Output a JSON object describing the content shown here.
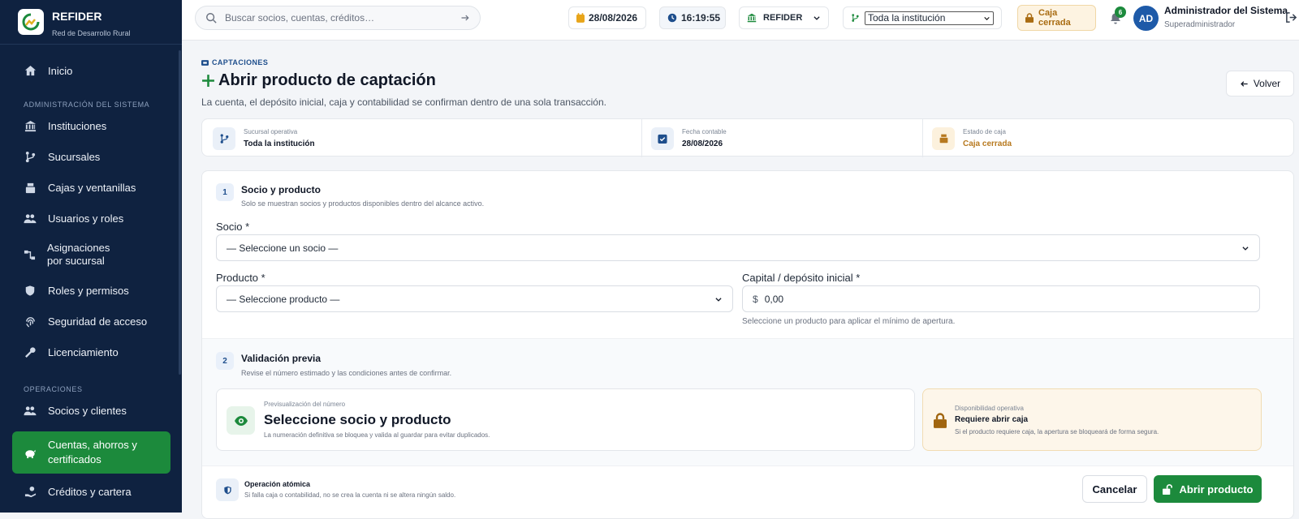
{
  "brand": {
    "name": "REFIDER",
    "tagline": "Red de Desarrollo Rural"
  },
  "sidebar": {
    "home": "Inicio",
    "section_admin": "ADMINISTRACIÓN DEL SISTEMA",
    "admin_items": [
      "Instituciones",
      "Sucursales",
      "Cajas y ventanillas",
      "Usuarios y roles",
      "Asignaciones por sucursal",
      "Roles y permisos",
      "Seguridad de acceso",
      "Licenciamiento"
    ],
    "section_ops": "OPERACIONES",
    "ops_items": [
      "Socios y clientes",
      "Cuentas, ahorros y certificados",
      "Créditos y cartera"
    ]
  },
  "topbar": {
    "search_placeholder": "Buscar socios, cuentas, créditos…",
    "date": "28/08/2026",
    "time": "16:19:55",
    "institution": "REFIDER",
    "scope": "Toda la institución",
    "cash_status": "Caja cerrada",
    "notifications": "6",
    "avatar": "AD",
    "user_name": "Administrador del Sistema",
    "user_role": "Superadministrador"
  },
  "page": {
    "breadcrumb": "CAPTACIONES",
    "title": "Abrir producto de captación",
    "subtitle": "La cuenta, el depósito inicial, caja y contabilidad se confirman dentro de una sola transacción.",
    "back": "Volver"
  },
  "info": {
    "branch_label": "Sucursal operativa",
    "branch_value": "Toda la institución",
    "date_label": "Fecha contable",
    "date_value": "28/08/2026",
    "cash_label": "Estado de caja",
    "cash_value": "Caja cerrada"
  },
  "form": {
    "step1": "1",
    "step1_title": "Socio y producto",
    "step1_desc": "Solo se muestran socios y productos disponibles dentro del alcance activo.",
    "member_label": "Socio *",
    "member_value": "— Seleccione un socio —",
    "product_label": "Producto *",
    "product_value": "— Seleccione producto —",
    "capital_label": "Capital / depósito inicial *",
    "currency": "$",
    "capital_value": "0,00",
    "capital_hint": "Seleccione un producto para aplicar el mínimo de apertura.",
    "step2": "2",
    "step2_title": "Validación previa",
    "step2_desc": "Revise el número estimado y las condiciones antes de confirmar.",
    "preview_label": "Previsualización del número",
    "preview_value": "Seleccione socio y producto",
    "preview_note": "La numeración definitiva se bloquea y valida al guardar para evitar duplicados.",
    "avail_label": "Disponibilidad operativa",
    "avail_value": "Requiere abrir caja",
    "avail_note": "Si el producto requiere caja, la apertura se bloqueará de forma segura."
  },
  "footer": {
    "atomic_title": "Operación atómica",
    "atomic_desc": "Si falla caja o contabilidad, no se crea la cuenta ni se altera ningún saldo.",
    "cancel": "Cancelar",
    "open": "Abrir producto"
  },
  "colors": {
    "sidebar": "#0f2240",
    "accent": "#1c8a3c",
    "primary": "#1e4e8c",
    "warning": "#b7791f"
  }
}
